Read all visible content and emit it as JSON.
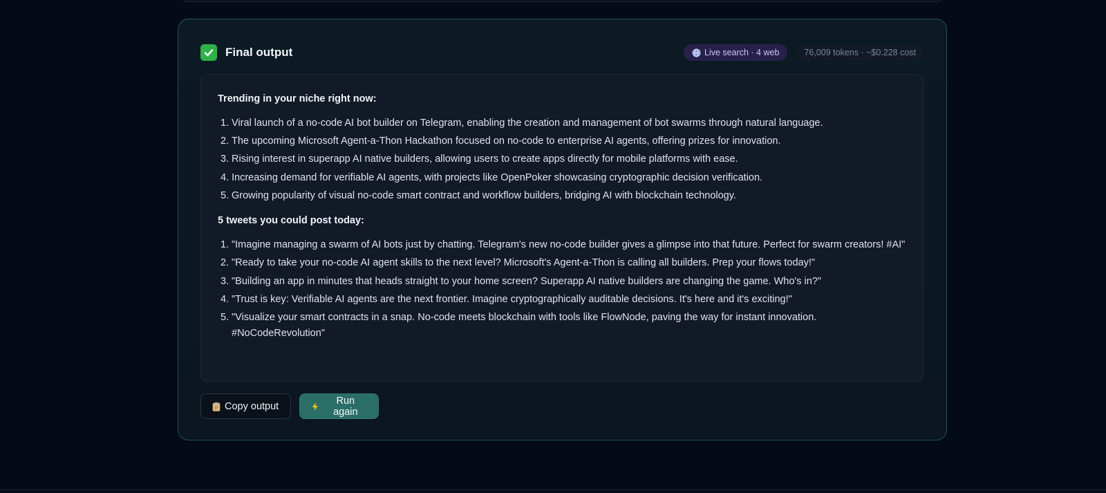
{
  "card": {
    "title": "Final output",
    "badges": {
      "live_search": "Live search · 4 web",
      "usage": "76,009 tokens · ~$0.228 cost"
    }
  },
  "output": {
    "section1_heading": "Trending in your niche right now:",
    "trends": [
      {
        "num": "1.",
        "text": "Viral launch of a no-code AI bot builder on Telegram, enabling the creation and management of bot swarms through natural language."
      },
      {
        "num": "2.",
        "text": "The upcoming Microsoft Agent-a-Thon Hackathon focused on no-code to enterprise AI agents, offering prizes for innovation."
      },
      {
        "num": "3.",
        "text": "Rising interest in superapp AI native builders, allowing users to create apps directly for mobile platforms with ease."
      },
      {
        "num": "4.",
        "text": "Increasing demand for verifiable AI agents, with projects like OpenPoker showcasing cryptographic decision verification."
      },
      {
        "num": "5.",
        "text": "Growing popularity of visual no-code smart contract and workflow builders, bridging AI with blockchain technology."
      }
    ],
    "section2_heading": "5 tweets you could post today:",
    "tweets": [
      {
        "num": "1.",
        "text": "\"Imagine managing a swarm of AI bots just by chatting. Telegram's new no-code builder gives a glimpse into that future. Perfect for swarm creators! #AI\""
      },
      {
        "num": "2.",
        "text": "\"Ready to take your no-code AI agent skills to the next level? Microsoft's Agent-a-Thon is calling all builders. Prep your flows today!\""
      },
      {
        "num": "3.",
        "text": "\"Building an app in minutes that heads straight to your home screen? Superapp AI native builders are changing the game. Who's in?\""
      },
      {
        "num": "4.",
        "text": "\"Trust is key: Verifiable AI agents are the next frontier. Imagine cryptographically auditable decisions. It's here and it's exciting!\""
      },
      {
        "num": "5.",
        "text": "\"Visualize your smart contracts in a snap. No-code meets blockchain with tools like FlowNode, paving the way for instant innovation. #NoCodeRevolution\""
      }
    ]
  },
  "actions": {
    "copy_label": "Copy output",
    "run_label": "Run again"
  },
  "icons": {
    "title_icon": "check-mark-icon",
    "live_icon": "globe-icon",
    "copy_icon": "clipboard-icon",
    "run_icon": "lightning-icon"
  },
  "colors": {
    "accent": "#2b6e67",
    "card_border": "#24544f",
    "check_green": "#2fb24a",
    "live_badge_bg": "#27214a"
  }
}
